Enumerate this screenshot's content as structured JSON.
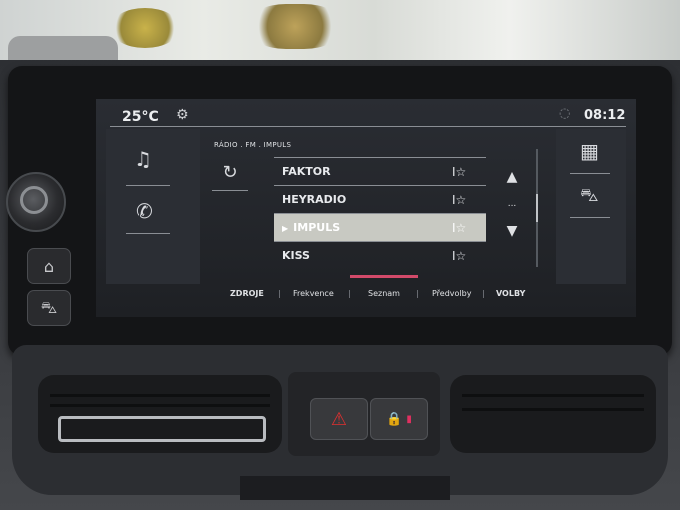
{
  "status_bar": {
    "temperature": "25°C",
    "settings_icon": "gear-icon",
    "signal_icon": "signal-icon",
    "clock": "08:12"
  },
  "left_menu": {
    "items": [
      {
        "icon": "music-note-icon",
        "glyph": "♫"
      },
      {
        "icon": "phone-icon",
        "glyph": "✆"
      }
    ]
  },
  "right_menu": {
    "items": [
      {
        "icon": "grid-apps-icon",
        "glyph": "▦"
      },
      {
        "icon": "car-icon",
        "glyph": "⛍"
      }
    ]
  },
  "radio": {
    "breadcrumb": "RÁDIO . FM . IMPULS",
    "refresh_glyph": "↻",
    "stations": [
      {
        "name": "FAKTOR",
        "fav": "I☆"
      },
      {
        "name": "HEYRADIO",
        "fav": "I☆"
      },
      {
        "name": "IMPULS",
        "fav": "I☆",
        "playing": "▶"
      },
      {
        "name": "KISS",
        "fav": "I☆"
      }
    ],
    "scroll_up": "▲",
    "scroll_dots": "...",
    "scroll_down": "▼"
  },
  "bottom_tabs": [
    {
      "label": "ZDROJE"
    },
    {
      "label": "Frekvence"
    },
    {
      "label": "Seznam"
    },
    {
      "label": "Předvolby"
    },
    {
      "label": "VOLBY"
    }
  ],
  "hardware": {
    "home_glyph": "⌂",
    "car_glyph": "⛍",
    "hazard_glyph": "⚠",
    "lock_glyph": "🔒"
  },
  "colors": {
    "active_row": "#c8c9c2",
    "tab_indicator": "#d24a6a",
    "hazard_red": "#e03030"
  }
}
